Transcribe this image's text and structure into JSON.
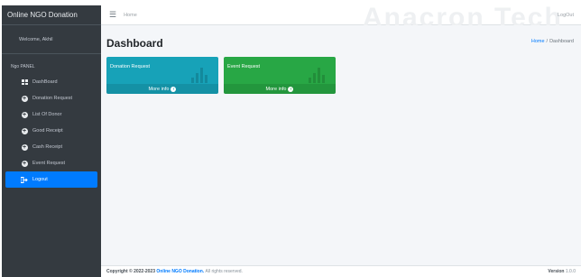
{
  "brand": {
    "title": "Online NGO Donation"
  },
  "user_panel": {
    "welcome": "Welcome, Akhil"
  },
  "sidebar": {
    "header": "Ngo PANEL",
    "items": [
      {
        "label": "DashBoard",
        "icon": "dashboard-grid-icon"
      },
      {
        "label": "Donation Request",
        "icon": "plus-circle-icon"
      },
      {
        "label": "List Of Donor",
        "icon": "plus-circle-icon"
      },
      {
        "label": "Good Receipt",
        "icon": "plus-circle-icon"
      },
      {
        "label": "Cash Receipt",
        "icon": "plus-circle-icon"
      },
      {
        "label": "Event Request",
        "icon": "plus-circle-icon"
      },
      {
        "label": "Logout",
        "icon": "logout-icon",
        "active": true
      }
    ]
  },
  "navbar": {
    "home": "Home",
    "logout": "LogOut",
    "watermark": "Anacron Tech"
  },
  "page": {
    "title": "Dashboard"
  },
  "breadcrumb": {
    "home": "Home",
    "separator": "/",
    "current": "Dashboard"
  },
  "boxes": [
    {
      "title": "Donation Request",
      "footer": "More info",
      "color": "#17a2b8"
    },
    {
      "title": "Event Request",
      "footer": "More info",
      "color": "#28a745"
    }
  ],
  "footer": {
    "copyright_prefix": "Copyright © 2022-2023",
    "link": "Online NGO Donation.",
    "suffix": "All rights reserved.",
    "version_label": "Version",
    "version_value": "1.0.0"
  },
  "colors": {
    "sidebar": "#343a40",
    "active": "#007bff",
    "content_bg": "#f4f6f9"
  }
}
